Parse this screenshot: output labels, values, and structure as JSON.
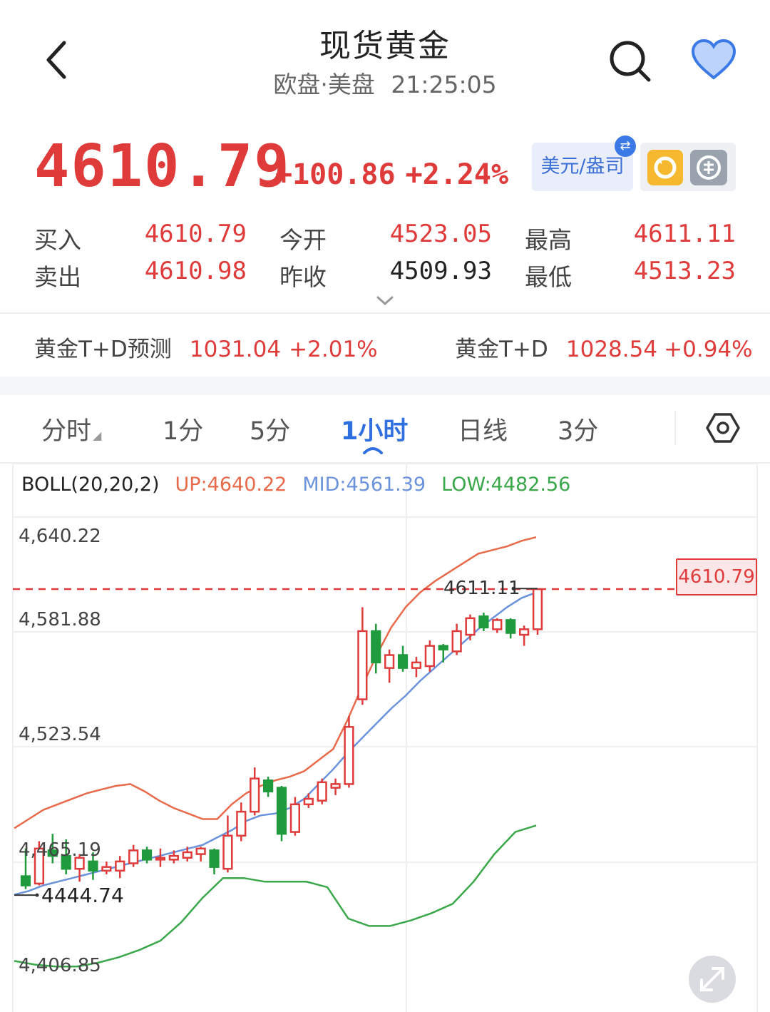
{
  "header": {
    "title": "现货黄金",
    "session": "欧盘·美盘",
    "time": "21:25:05"
  },
  "quote": {
    "price": "4610.79",
    "change": "+100.86",
    "change_pct": "+2.24%",
    "currency_label": "美元/盎司",
    "buy_label": "买入",
    "buy": "4610.79",
    "sell_label": "卖出",
    "sell": "4610.98",
    "open_label": "今开",
    "open": "4523.05",
    "prev_close_label": "昨收",
    "prev_close": "4509.93",
    "high_label": "最高",
    "high": "4611.11",
    "low_label": "最低",
    "low": "4513.23"
  },
  "related": [
    {
      "name": "黄金T+D预测",
      "value": "1031.04",
      "pct": "+2.01%"
    },
    {
      "name": "黄金T+D",
      "value": "1028.54",
      "pct": "+0.94%"
    }
  ],
  "tabs": [
    {
      "label": "分时",
      "active": false
    },
    {
      "label": "1分",
      "active": false
    },
    {
      "label": "5分",
      "active": false
    },
    {
      "label": "1小时",
      "active": true
    },
    {
      "label": "日线",
      "active": false
    },
    {
      "label": "3分",
      "active": false
    }
  ],
  "colors": {
    "up": "#e03b3b",
    "down": "#1f9a3c",
    "accent": "#2f6fe0",
    "boll_up": "#e86a4a",
    "boll_mid": "#6b93dc",
    "boll_low": "#3aa84a"
  },
  "icons": {
    "back": "chevron-left-icon",
    "search": "search-icon",
    "favorite": "heart-icon",
    "settings": "hexagon-settings-icon",
    "fullscreen": "expand-arrows-icon"
  },
  "chart_data": {
    "type": "candlestick",
    "indicator": "BOLL(20,20,2)",
    "boll_up_label": "UP:4640.22",
    "boll_mid_label": "MID:4561.39",
    "boll_low_label": "LOW:4482.56",
    "ylim": [
      4395,
      4650
    ],
    "y_ticks": [
      "4,640.22",
      "4,581.88",
      "4,523.54",
      "4,465.19",
      "4,406.85"
    ],
    "y_tick_values": [
      4640.22,
      4581.88,
      4523.54,
      4465.19,
      4406.85
    ],
    "current_price": 4610.79,
    "current_label": "4610.79",
    "max_label": "4611.11",
    "max_value": 4611.11,
    "min_label": "4444.74",
    "min_value": 4444.74,
    "candles": [
      {
        "o": 4455,
        "h": 4470,
        "l": 4448,
        "c": 4450
      },
      {
        "o": 4451,
        "h": 4474,
        "l": 4450,
        "c": 4470
      },
      {
        "o": 4469,
        "h": 4478,
        "l": 4462,
        "c": 4466
      },
      {
        "o": 4466,
        "h": 4475,
        "l": 4456,
        "c": 4459
      },
      {
        "o": 4459,
        "h": 4467,
        "l": 4452,
        "c": 4465
      },
      {
        "o": 4463,
        "h": 4468,
        "l": 4453,
        "c": 4458
      },
      {
        "o": 4458,
        "h": 4463,
        "l": 4456,
        "c": 4460
      },
      {
        "o": 4458,
        "h": 4466,
        "l": 4454,
        "c": 4463
      },
      {
        "o": 4462,
        "h": 4472,
        "l": 4460,
        "c": 4469
      },
      {
        "o": 4469,
        "h": 4471,
        "l": 4462,
        "c": 4464
      },
      {
        "o": 4464,
        "h": 4470,
        "l": 4460,
        "c": 4465
      },
      {
        "o": 4464,
        "h": 4469,
        "l": 4462,
        "c": 4466
      },
      {
        "o": 4465,
        "h": 4471,
        "l": 4463,
        "c": 4468
      },
      {
        "o": 4467,
        "h": 4471,
        "l": 4463,
        "c": 4470
      },
      {
        "o": 4469,
        "h": 4470,
        "l": 4456,
        "c": 4460
      },
      {
        "o": 4459,
        "h": 4488,
        "l": 4457,
        "c": 4477
      },
      {
        "o": 4477,
        "h": 4495,
        "l": 4474,
        "c": 4490
      },
      {
        "o": 4490,
        "h": 4514,
        "l": 4488,
        "c": 4508
      },
      {
        "o": 4507,
        "h": 4509,
        "l": 4498,
        "c": 4501
      },
      {
        "o": 4503,
        "h": 4504,
        "l": 4474,
        "c": 4478
      },
      {
        "o": 4479,
        "h": 4498,
        "l": 4477,
        "c": 4494
      },
      {
        "o": 4494,
        "h": 4500,
        "l": 4492,
        "c": 4497
      },
      {
        "o": 4496,
        "h": 4508,
        "l": 4494,
        "c": 4506
      },
      {
        "o": 4503,
        "h": 4508,
        "l": 4499,
        "c": 4505
      },
      {
        "o": 4505,
        "h": 4542,
        "l": 4503,
        "c": 4536
      },
      {
        "o": 4551,
        "h": 4601,
        "l": 4548,
        "c": 4588
      },
      {
        "o": 4588,
        "h": 4592,
        "l": 4565,
        "c": 4571
      },
      {
        "o": 4568,
        "h": 4578,
        "l": 4560,
        "c": 4575
      },
      {
        "o": 4575,
        "h": 4580,
        "l": 4566,
        "c": 4568
      },
      {
        "o": 4568,
        "h": 4574,
        "l": 4563,
        "c": 4571
      },
      {
        "o": 4569,
        "h": 4583,
        "l": 4566,
        "c": 4580
      },
      {
        "o": 4580,
        "h": 4581,
        "l": 4571,
        "c": 4578
      },
      {
        "o": 4577,
        "h": 4592,
        "l": 4575,
        "c": 4588
      },
      {
        "o": 4586,
        "h": 4597,
        "l": 4583,
        "c": 4595
      },
      {
        "o": 4596,
        "h": 4598,
        "l": 4588,
        "c": 4590
      },
      {
        "o": 4589,
        "h": 4595,
        "l": 4587,
        "c": 4594
      },
      {
        "o": 4594,
        "h": 4595,
        "l": 4584,
        "c": 4587
      },
      {
        "o": 4586,
        "h": 4591,
        "l": 4580,
        "c": 4589
      },
      {
        "o": 4589,
        "h": 4611.11,
        "l": 4586,
        "c": 4610.79
      }
    ],
    "boll_up": [
      4481,
      4486,
      4491,
      4494,
      4497,
      4500,
      4502,
      4504,
      4505,
      4501,
      4496,
      4492,
      4489,
      4486,
      4486,
      4494,
      4500,
      4504,
      4507,
      4509,
      4512,
      4518,
      4524,
      4540,
      4558,
      4575,
      4590,
      4601,
      4609,
      4615,
      4620,
      4625,
      4630,
      4632,
      4634,
      4637,
      4640.22
    ],
    "boll_mid": [
      4445,
      4447,
      4450,
      4452,
      4454,
      4456,
      4458,
      4460,
      4462,
      4464,
      4466,
      4468,
      4470,
      4472,
      4476,
      4480,
      4485,
      4488,
      4489,
      4492,
      4497,
      4505,
      4513,
      4522,
      4530,
      4538,
      4546,
      4553,
      4561,
      4568,
      4575,
      4582,
      4589,
      4595,
      4601,
      4606,
      4561.39
    ],
    "boll_low": [
      4409,
      4407,
      4406,
      4406,
      4408,
      4411,
      4415,
      4420,
      4430,
      4443,
      4454,
      4454,
      4452,
      4452,
      4452,
      4449,
      4432,
      4428,
      4428,
      4431,
      4435,
      4440,
      4452,
      4467,
      4479,
      4482.56
    ]
  }
}
